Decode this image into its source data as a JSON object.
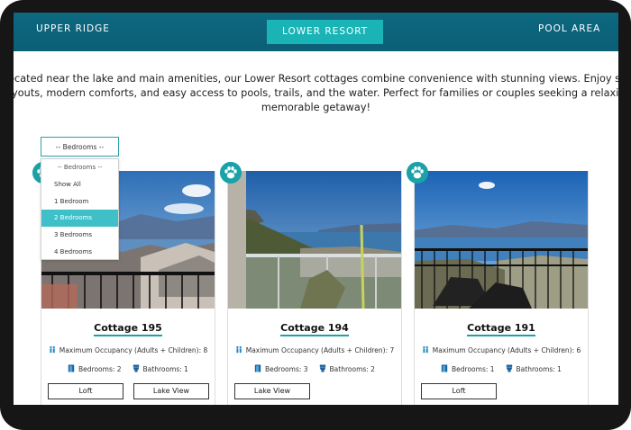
{
  "nav": {
    "items": [
      {
        "label": "UPPER RIDGE",
        "active": false
      },
      {
        "label": "LOWER RESORT",
        "active": true
      },
      {
        "label": "POOL AREA",
        "active": false
      }
    ]
  },
  "intro": {
    "line1": "Located near the lake and main amenities, our Lower Resort cottages combine convenience with stunning views. Enjoy spacious",
    "line2": "layouts, modern comforts, and easy access to pools, trails, and the water. Perfect for families or couples seeking a relaxing and",
    "line3": "memorable getaway!"
  },
  "filter": {
    "selected_label": "-- Bedrooms --",
    "options": [
      "-- Bedrooms --",
      "Show All",
      "1 Bedroom",
      "2 Bedrooms",
      "3 Bedrooms",
      "4 Bedrooms"
    ],
    "highlighted": "2 Bedrooms"
  },
  "cards": [
    {
      "title": "Cottage 195",
      "occupancy": "Maximum Occupancy (Adults + Children): 8",
      "bedrooms": "Bedrooms: 2",
      "bathrooms": "Bathrooms: 1",
      "tags": [
        "Loft",
        "Lake View"
      ]
    },
    {
      "title": "Cottage 194",
      "occupancy": "Maximum Occupancy (Adults + Children): 7",
      "bedrooms": "Bedrooms: 3",
      "bathrooms": "Bathrooms: 2",
      "tags": [
        "Lake View"
      ]
    },
    {
      "title": "Cottage 191",
      "occupancy": "Maximum Occupancy (Adults + Children): 6",
      "bedrooms": "Bedrooms: 1",
      "bathrooms": "Bathrooms: 1",
      "tags": [
        "Loft"
      ]
    }
  ],
  "colors": {
    "nav": "#0b6680",
    "accent": "#1ab4b6",
    "highlight": "#3fc0c8"
  },
  "icons": {
    "pet": "paw-icon",
    "occupancy": "people-icon",
    "bedroom": "door-icon",
    "bathroom": "toilet-icon"
  }
}
